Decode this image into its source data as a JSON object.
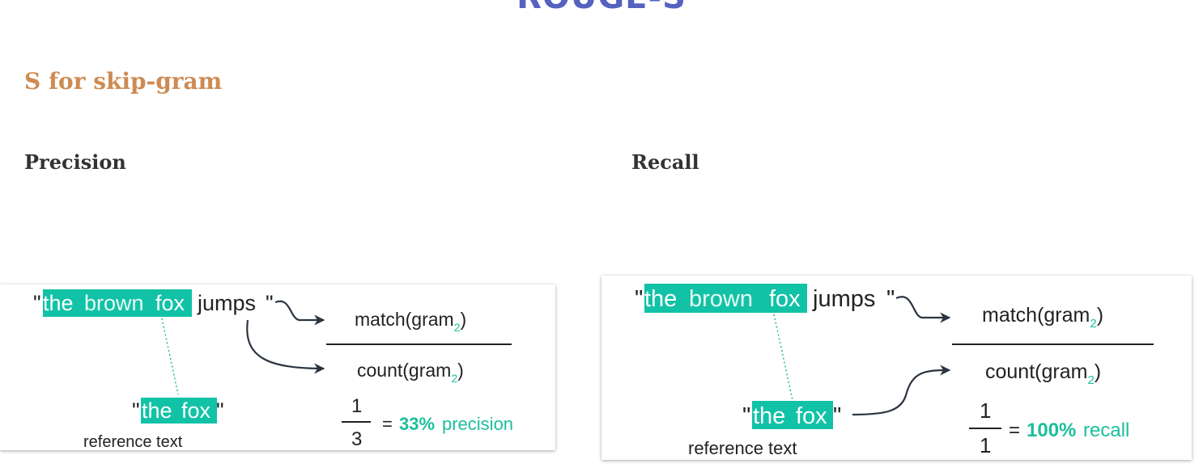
{
  "title": "ROUGE-S",
  "subtitle": "S for skip-gram",
  "precision": {
    "heading": "Precision",
    "quote_open": "\"",
    "quote_close": "\"",
    "candidate_words": [
      "the",
      "brown",
      "fox"
    ],
    "candidate_tail": "jumps",
    "reference_words": [
      "the",
      "fox"
    ],
    "reference_label": "reference text",
    "numerator": "match(gram",
    "denominator": "count(gram",
    "sub": "2",
    "close_paren": ")",
    "frac_num": "1",
    "frac_den": "3",
    "equals": "=",
    "result_value": "33%",
    "result_word": "precision"
  },
  "recall": {
    "heading": "Recall",
    "quote_open": "\"",
    "quote_close": "\"",
    "candidate_words": [
      "the",
      "brown",
      "fox"
    ],
    "candidate_tail": "jumps",
    "reference_words": [
      "the",
      "fox"
    ],
    "reference_label": "reference text",
    "numerator": "match(gram",
    "denominator": "count(gram",
    "sub": "2",
    "close_paren": ")",
    "frac_num": "1",
    "frac_den": "1",
    "equals": "=",
    "result_value": "100%",
    "result_word": "recall"
  },
  "colors": {
    "title": "#5562c0",
    "subtitle": "#cd8b53",
    "highlight": "#12c2a6",
    "accent_text": "#1bbf9c",
    "arrow": "#2b3440"
  }
}
